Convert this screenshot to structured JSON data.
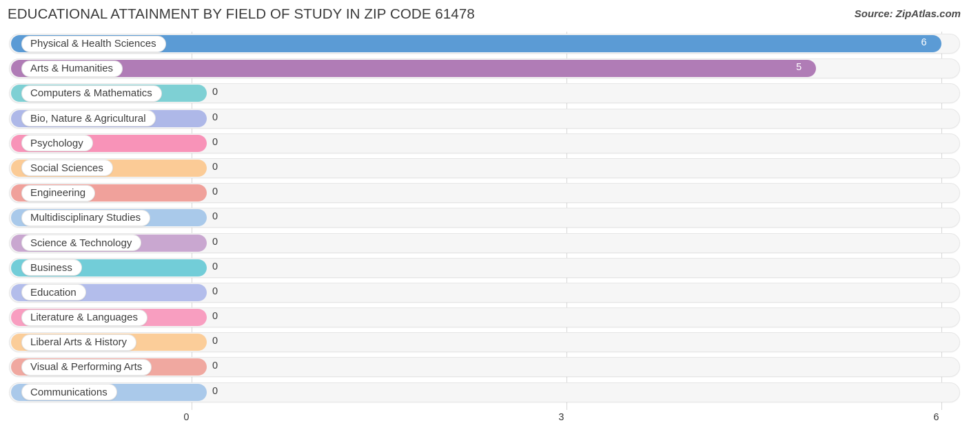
{
  "header": {
    "title": "EDUCATIONAL ATTAINMENT BY FIELD OF STUDY IN ZIP CODE 61478",
    "source": "Source: ZipAtlas.com"
  },
  "chart_data": {
    "type": "bar",
    "orientation": "horizontal",
    "title": "EDUCATIONAL ATTAINMENT BY FIELD OF STUDY IN ZIP CODE 61478",
    "xlabel": "",
    "ylabel": "",
    "xlim": [
      0,
      6
    ],
    "grid": true,
    "legend": "none",
    "xticks": [
      "0",
      "3",
      "6"
    ],
    "xtick_values": [
      0,
      3,
      6
    ],
    "categories": [
      "Physical & Health Sciences",
      "Arts & Humanities",
      "Computers & Mathematics",
      "Bio, Nature & Agricultural",
      "Psychology",
      "Social Sciences",
      "Engineering",
      "Multidisciplinary Studies",
      "Science & Technology",
      "Business",
      "Education",
      "Literature & Languages",
      "Liberal Arts & History",
      "Visual & Performing Arts",
      "Communications"
    ],
    "values": [
      6,
      5,
      0,
      0,
      0,
      0,
      0,
      0,
      0,
      0,
      0,
      0,
      0,
      0,
      0
    ],
    "value_labels": [
      "6",
      "5",
      "0",
      "0",
      "0",
      "0",
      "0",
      "0",
      "0",
      "0",
      "0",
      "0",
      "0",
      "0",
      "0"
    ],
    "colors": [
      "#5b9bd5",
      "#b07cb6",
      "#7ed0d4",
      "#aeb8e8",
      "#f893b8",
      "#fbcb96",
      "#f0a19b",
      "#a9c9ea",
      "#c9a7d0",
      "#72cdd8",
      "#b3bdeb",
      "#f89ec0",
      "#fbcd99",
      "#f0a8a0",
      "#aac9ea"
    ]
  },
  "style": {
    "track_color": "#f6f6f6",
    "gridline_color": "#d6d6d6",
    "label_pill_bg": "#ffffff",
    "text_color": "#3d3d3d"
  }
}
